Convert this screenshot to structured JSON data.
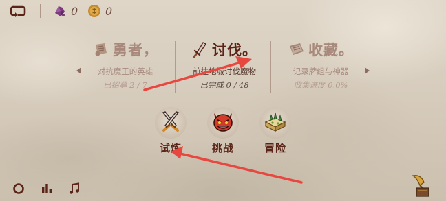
{
  "resources": {
    "gem_count": "0",
    "coin_count": "0"
  },
  "categories": [
    {
      "name": "勇者，",
      "description": "对抗魔王的英雄",
      "progress": "已招募 2 / 7",
      "icon": "scroll-badge-icon",
      "active": false
    },
    {
      "name": "讨伐。",
      "description": "前往地城讨伐魔物",
      "progress": "已完成 0 / 48",
      "icon": "sword-icon",
      "active": true
    },
    {
      "name": "收藏。",
      "description": "记录牌组与神器",
      "progress": "收集进度 0.0%",
      "icon": "book-icon",
      "active": false
    }
  ],
  "modes": [
    {
      "label": "试炼",
      "icon": "crossed-swords-icon"
    },
    {
      "label": "挑战",
      "icon": "demon-face-icon"
    },
    {
      "label": "冒险",
      "icon": "map-crate-icon"
    }
  ],
  "bottom_bar": {
    "icons": [
      "record-circle-icon",
      "stats-bars-icon",
      "music-note-icon",
      "gramophone-icon"
    ]
  },
  "colors": {
    "primary_text": "#5a2418",
    "muted_text": "#a7887b",
    "annotation_arrow": "#e8473f"
  }
}
